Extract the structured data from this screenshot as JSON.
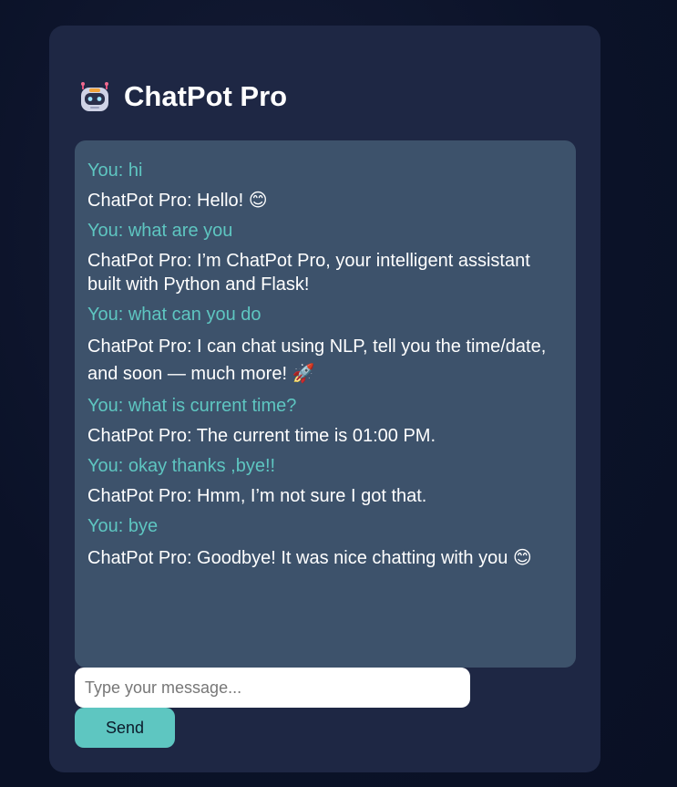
{
  "app": {
    "icon": "robot-icon",
    "title": "ChatPot Pro"
  },
  "colors": {
    "background": "#0c1329",
    "card": "#1e2744",
    "chat_box": "#3d526b",
    "user_text": "#5ec6c1",
    "bot_text": "#ffffff",
    "send_button": "#5ec6c1"
  },
  "messages": [
    {
      "sender": "user",
      "text": "You: hi"
    },
    {
      "sender": "bot",
      "text": "ChatPot Pro: Hello! 😊"
    },
    {
      "sender": "user",
      "text": "You: what are you"
    },
    {
      "sender": "bot",
      "text": "ChatPot Pro: I’m ChatPot Pro, your intelligent assistant built with Python and Flask!"
    },
    {
      "sender": "user",
      "text": "You: what can you do"
    },
    {
      "sender": "bot",
      "text": "ChatPot Pro: I can chat using NLP, tell you the time/date, and soon — much more! 🚀"
    },
    {
      "sender": "user",
      "text": "You: what is current time?"
    },
    {
      "sender": "bot",
      "text": "ChatPot Pro: The current time is 01:00 PM."
    },
    {
      "sender": "user",
      "text": "You: okay thanks ,bye!!"
    },
    {
      "sender": "bot",
      "text": "ChatPot Pro: Hmm, I’m not sure I got that."
    },
    {
      "sender": "user",
      "text": "You: bye"
    },
    {
      "sender": "bot",
      "text": "ChatPot Pro: Goodbye! It was nice chatting with you 😊"
    }
  ],
  "input": {
    "value": "",
    "placeholder": "Type your message..."
  },
  "send_button": {
    "label": "Send"
  }
}
